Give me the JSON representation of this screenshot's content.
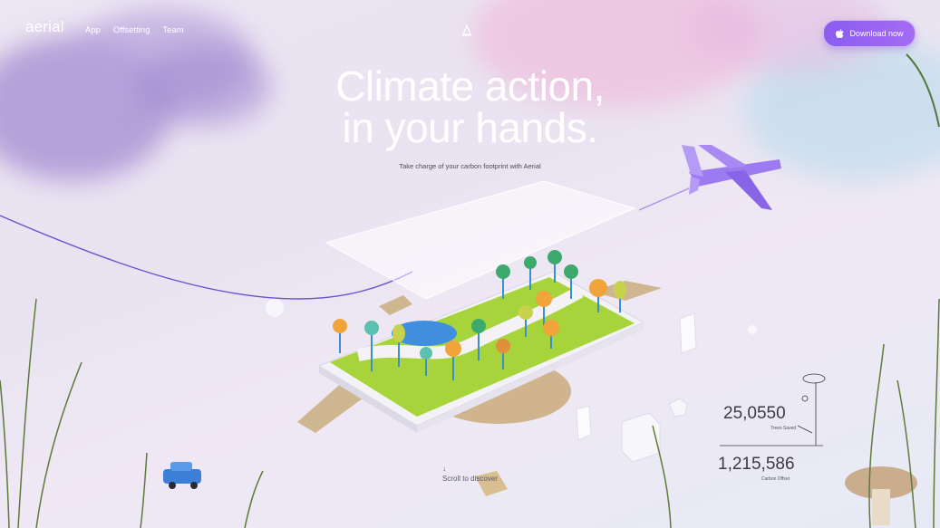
{
  "brand": {
    "logo": "aerial"
  },
  "nav": {
    "links": [
      "App",
      "Offsetting",
      "Team"
    ]
  },
  "cta": {
    "label": "Download now",
    "icon": "apple-icon"
  },
  "hero": {
    "title_line1": "Climate action,",
    "title_line2": "in your hands.",
    "subtitle": "Take charge of your carbon footprint with Aerial"
  },
  "stats": [
    {
      "value": "25,0550",
      "label": "Trees Saved"
    },
    {
      "value": "1,215,586",
      "label": "Carbon Offset"
    }
  ],
  "scroll": {
    "label": "Scroll to discover"
  },
  "colors": {
    "accent": "#8a5cf0",
    "line": "#6b4fd6",
    "grass": "#a7d43a"
  }
}
